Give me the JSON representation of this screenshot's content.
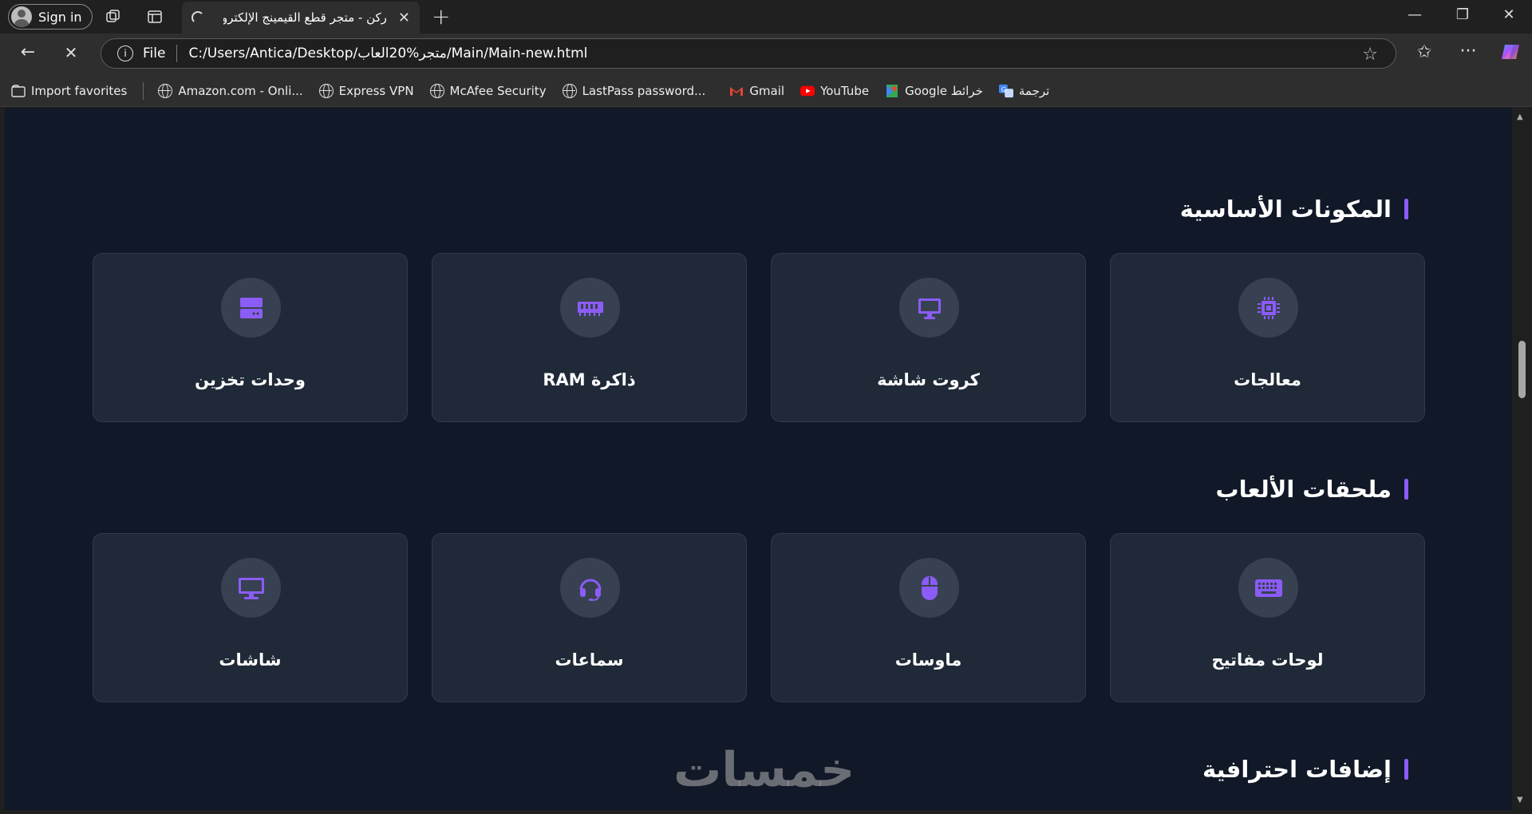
{
  "browser": {
    "signin_label": "Sign in",
    "tab_title": "ركن - متجر قطع القيمينج الإلكترونية",
    "address_scheme": "File",
    "address_url": "C:/Users/Antica/Desktop/متجر%20العاب/Main/Main-new.html",
    "bookmarks": [
      {
        "label": "Import favorites",
        "icon": "import-icon"
      },
      {
        "label": "Amazon.com - Onli...",
        "icon": "globe-icon"
      },
      {
        "label": "Express VPN",
        "icon": "globe-icon"
      },
      {
        "label": "McAfee Security",
        "icon": "globe-icon"
      },
      {
        "label": "LastPass password...",
        "icon": "globe-icon"
      },
      {
        "label": "Gmail",
        "icon": "gmail-icon"
      },
      {
        "label": "YouTube",
        "icon": "youtube-icon"
      },
      {
        "label": "Google خرائط",
        "icon": "maps-icon"
      },
      {
        "label": "ترجمة",
        "icon": "translate-icon"
      }
    ]
  },
  "sections": [
    {
      "title": "المكونات الأساسية",
      "cards": [
        {
          "label": "معالجات",
          "icon": "cpu-icon"
        },
        {
          "label": "كروت شاشة",
          "icon": "monitor-icon"
        },
        {
          "label": "ذاكرة RAM",
          "icon": "memory-icon"
        },
        {
          "label": "وحدات تخزين",
          "icon": "hdd-icon"
        }
      ]
    },
    {
      "title": "ملحقات الألعاب",
      "cards": [
        {
          "label": "لوحات مفاتيح",
          "icon": "keyboard-icon"
        },
        {
          "label": "ماوسات",
          "icon": "mouse-icon"
        },
        {
          "label": "سماعات",
          "icon": "headset-icon"
        },
        {
          "label": "شاشات",
          "icon": "display-icon"
        }
      ]
    },
    {
      "title": "إضافات احترافية",
      "cards": []
    }
  ],
  "watermark": "خمسات",
  "colors": {
    "accent": "#8b5cf6",
    "page_bg": "#111827",
    "card_bg": "#1f2937",
    "icon_circle": "#374151"
  }
}
